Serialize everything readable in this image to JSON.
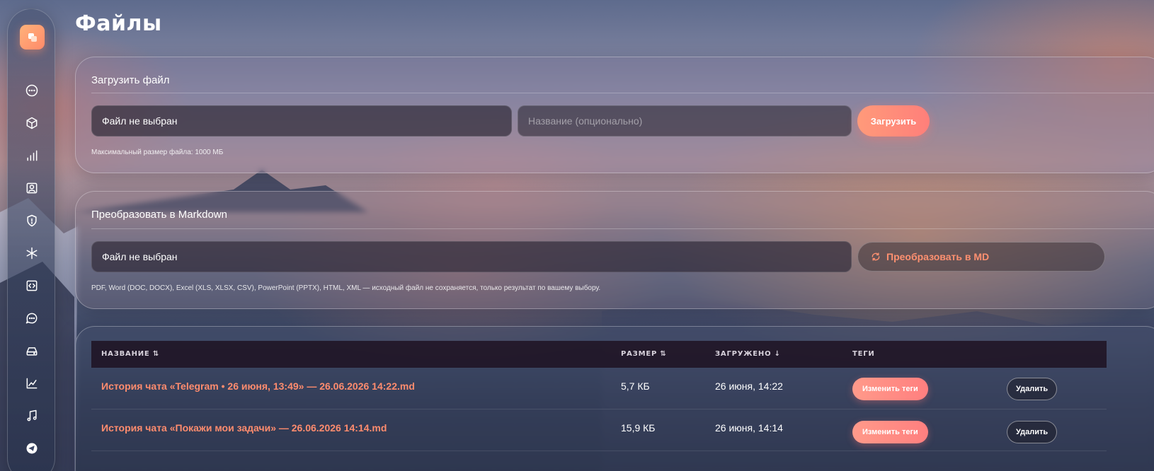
{
  "page": {
    "title": "Файлы"
  },
  "sidebar": {
    "icons": [
      "chat-icon",
      "box-icon",
      "bar-chart-icon",
      "contact-icon",
      "shield-icon",
      "asterisk-icon",
      "code-icon",
      "chat-bubble-icon",
      "drive-icon",
      "trend-chart-icon",
      "music-icon",
      "telegram-icon"
    ]
  },
  "upload": {
    "heading": "Загрузить файл",
    "file_field": "Файл не выбран",
    "name_placeholder": "Название (опционально)",
    "button": "Загрузить",
    "hint": "Максимальный размер файла: 1000 МБ"
  },
  "convert": {
    "heading": "Преобразовать в Markdown",
    "file_field": "Файл не выбран",
    "button": "Преобразовать в MD",
    "hint": "PDF, Word (DOC, DOCX), Excel (XLS, XLSX, CSV), PowerPoint (PPTX), HTML, XML — исходный файл не сохраняется, только результат по вашему выбору."
  },
  "table": {
    "headers": {
      "name": "НАЗВАНИЕ ⇅",
      "size": "РАЗМЕР ⇅",
      "uploaded": "ЗАГРУЖЕНО ↓",
      "tags": "ТЕГИ"
    },
    "rows": [
      {
        "name": "История чата «Telegram • 26 июня, 13:49» — 26.06.2026 14:22.md",
        "size": "5,7 КБ",
        "uploaded": "26 июня, 14:22",
        "tags_button": "Изменить теги",
        "delete_button": "Удалить"
      },
      {
        "name": "История чата «Покажи мои задачи» — 26.06.2026 14:14.md",
        "size": "15,9 КБ",
        "uploaded": "26 июня, 14:14",
        "tags_button": "Изменить теги",
        "delete_button": "Удалить"
      }
    ]
  }
}
